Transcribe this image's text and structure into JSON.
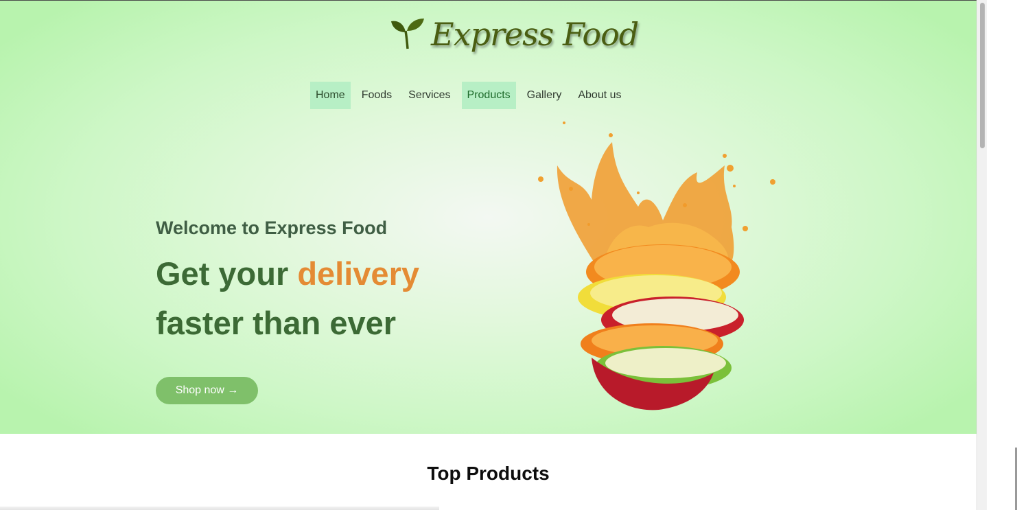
{
  "brand": {
    "name": "Express Food"
  },
  "nav": {
    "items": [
      {
        "label": "Home"
      },
      {
        "label": "Foods"
      },
      {
        "label": "Services"
      },
      {
        "label": "Products"
      },
      {
        "label": "Gallery"
      },
      {
        "label": "About us"
      }
    ],
    "active": "Home",
    "highlighted": "Products"
  },
  "hero": {
    "welcome": "Welcome to Express Food",
    "headline_part1": "Get your",
    "headline_accent": "delivery",
    "headline_line2": "faster than ever",
    "cta_label": "Shop now →",
    "image_icon": "fruit-splash-image"
  },
  "section": {
    "title": "Top Products"
  },
  "colors": {
    "hero_green": "#cdf7c6",
    "headline_green": "#3c6a35",
    "accent_orange": "#e48b34",
    "button_green": "#7fc06a",
    "nav_active_bg": "#b7efc5",
    "logo_olive": "#4a5e12"
  }
}
